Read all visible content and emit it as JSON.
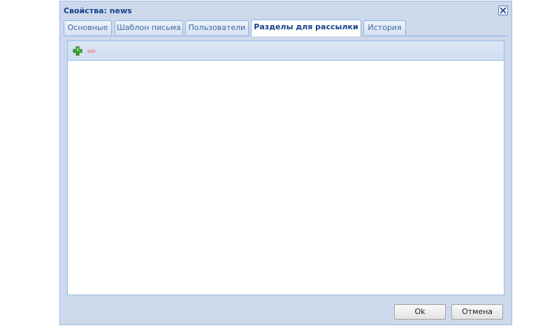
{
  "window": {
    "title": "Свойства: news",
    "close_icon": "close-icon"
  },
  "tabs": [
    {
      "label": "Основные",
      "active": false
    },
    {
      "label": "Шаблон письма",
      "active": false
    },
    {
      "label": "Пользователи",
      "active": false
    },
    {
      "label": "Разделы для рассылки",
      "active": true
    },
    {
      "label": "История",
      "active": false
    }
  ],
  "toolbar": {
    "add_icon": "plus-icon",
    "remove_icon": "minus-icon"
  },
  "buttons": {
    "ok_label": "Ok",
    "cancel_label": "Отмена"
  },
  "colors": {
    "title": "#15428b",
    "add": "#2e9b1f",
    "remove": "#e8a3b0"
  }
}
